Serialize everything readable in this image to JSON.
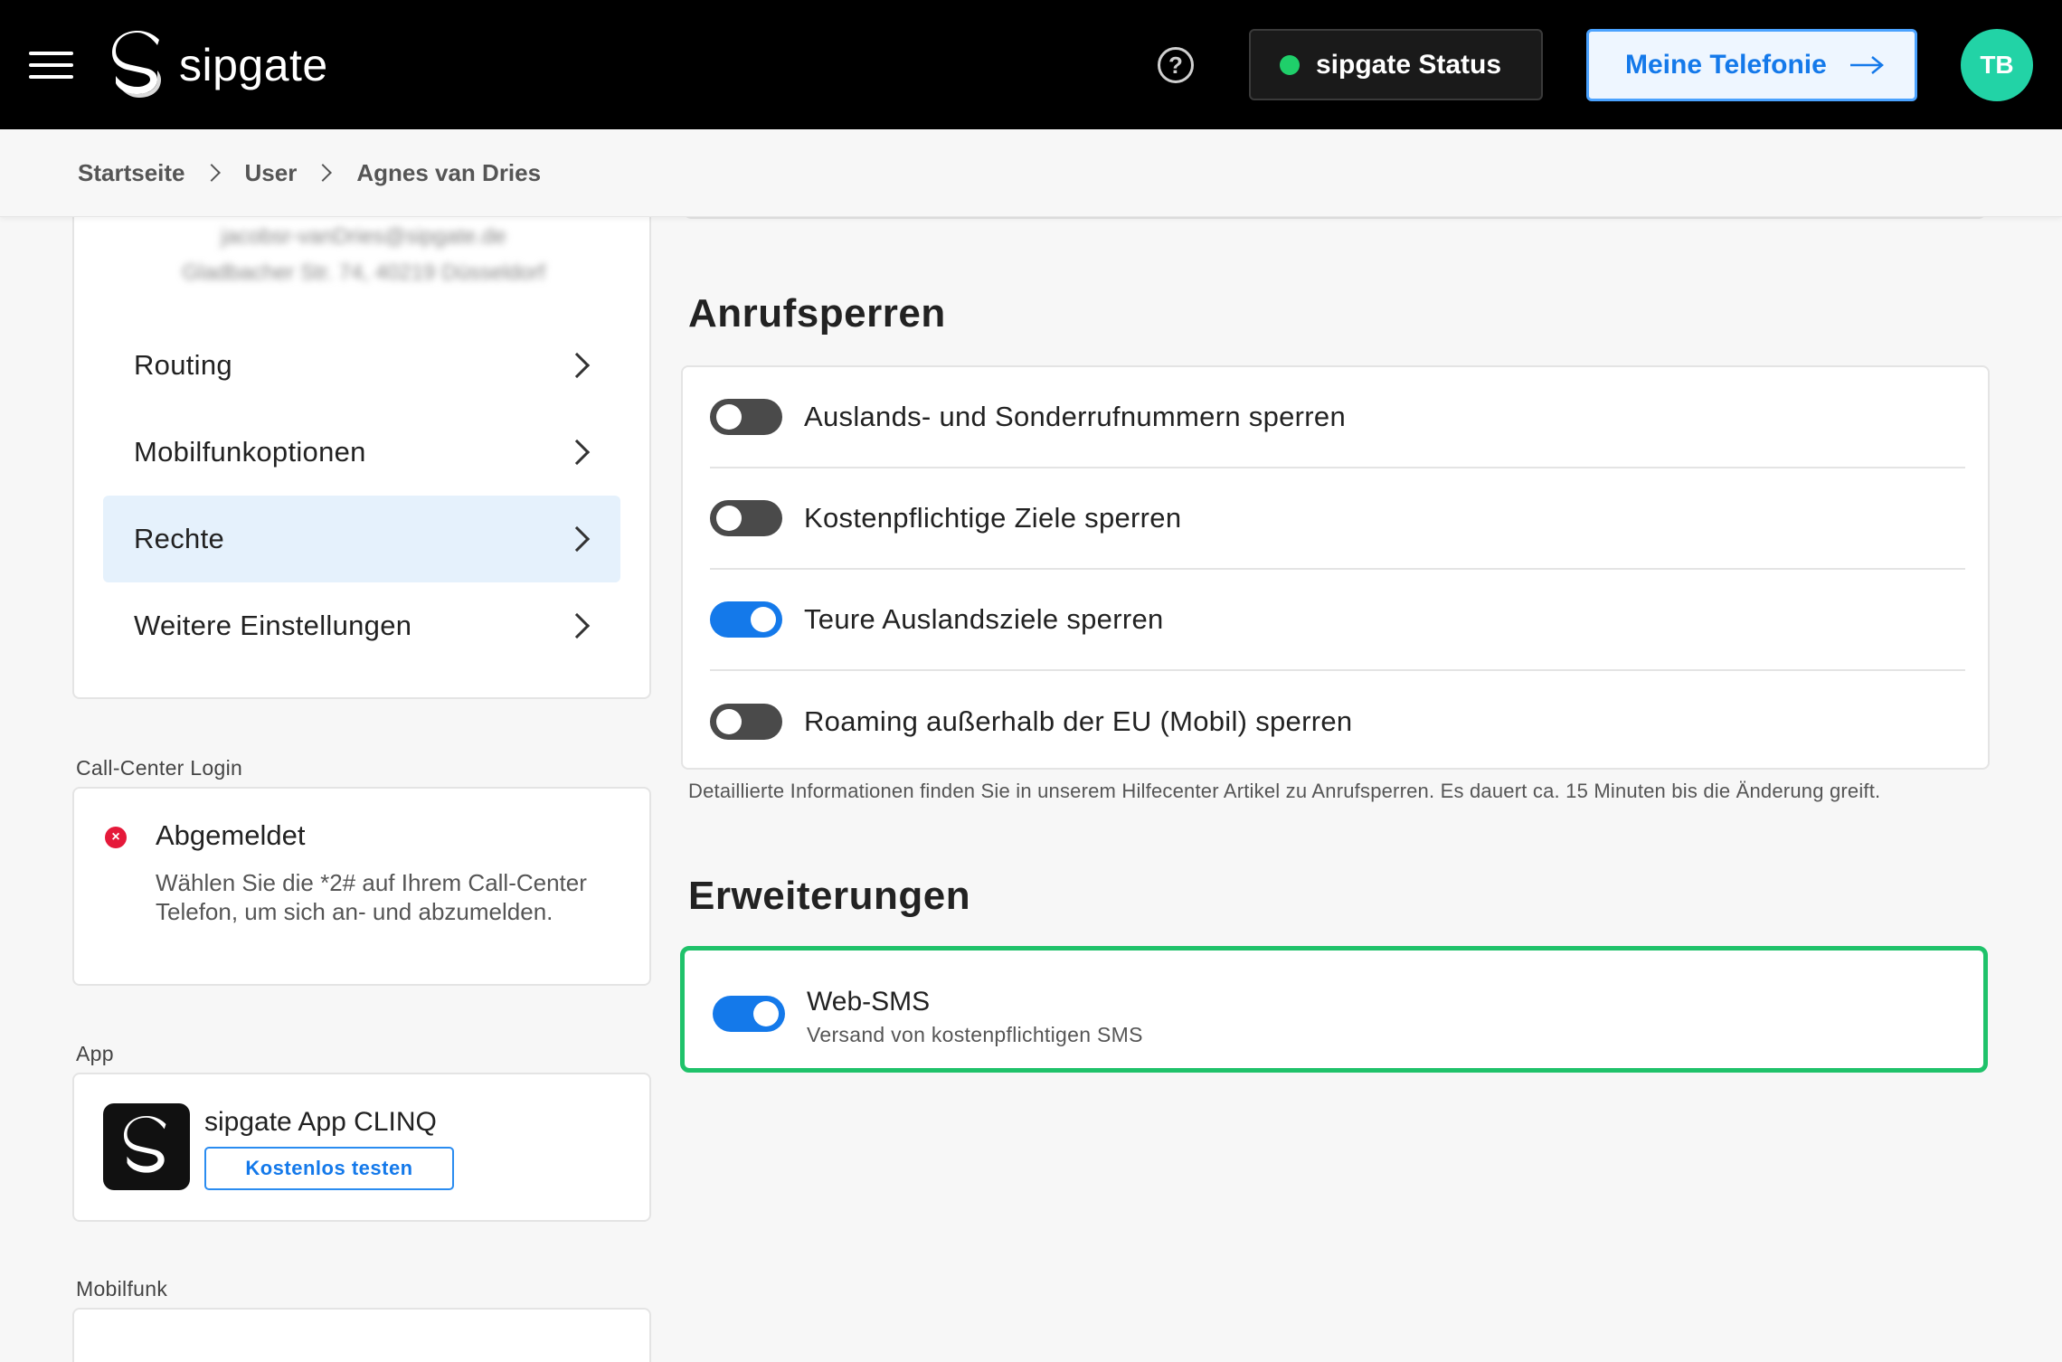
{
  "header": {
    "brand": "sipgate",
    "help_symbol": "?",
    "status_label": "sipgate Status",
    "status_color": "#1fcf6a",
    "telefonie_label": "Meine Telefonie",
    "avatar_initials": "TB",
    "avatar_color": "#22d3a6"
  },
  "breadcrumb": [
    "Startseite",
    "User",
    "Agnes van Dries"
  ],
  "sidebar": {
    "blurred_email": "jacobsr-vanDries@sipgate.de",
    "blurred_address": "Gladbacher Str. 74, 40219 Düsseldorf",
    "items": [
      {
        "label": "Routing",
        "active": false
      },
      {
        "label": "Mobilfunkoptionen",
        "active": false
      },
      {
        "label": "Rechte",
        "active": true
      },
      {
        "label": "Weitere Einstellungen",
        "active": false
      }
    ]
  },
  "callcenter": {
    "section_label": "Call-Center Login",
    "status": "Abgemeldet",
    "status_icon": "×",
    "description": "Wählen Sie die *2# auf Ihrem Call-Center Telefon, um sich an- und abzumelden."
  },
  "app": {
    "section_label": "App",
    "title": "sipgate App CLINQ",
    "button": "Kostenlos testen"
  },
  "mobilfunk": {
    "section_label": "Mobilfunk"
  },
  "anrufsperren": {
    "heading": "Anrufsperren",
    "toggles": [
      {
        "label": "Auslands- und Sonderrufnummern sperren",
        "on": false
      },
      {
        "label": "Kostenpflichtige Ziele sperren",
        "on": false
      },
      {
        "label": "Teure Auslandsziele sperren",
        "on": true
      },
      {
        "label": "Roaming außerhalb der EU (Mobil) sperren",
        "on": false
      }
    ],
    "info": "Detaillierte Informationen finden Sie in unserem Hilfecenter Artikel zu Anrufsperren. Es dauert ca. 15 Minuten bis die Änderung greift."
  },
  "erweiterungen": {
    "heading": "Erweiterungen",
    "websms_title": "Web-SMS",
    "websms_sub": "Versand von kostenpflichtigen SMS",
    "websms_on": true,
    "highlight_color": "#1fc26a"
  }
}
